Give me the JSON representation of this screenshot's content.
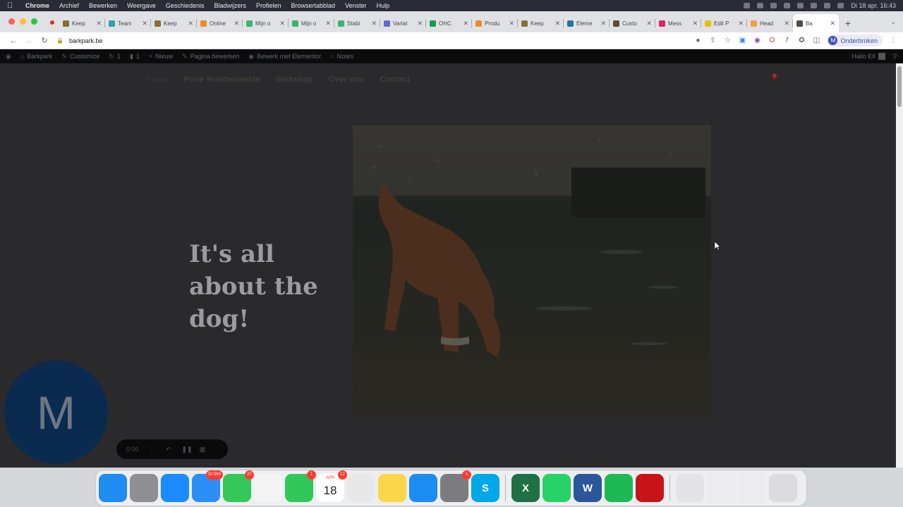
{
  "menubar": {
    "app": "Chrome",
    "items": [
      "Archief",
      "Bewerken",
      "Weergave",
      "Geschiedenis",
      "Bladwijzers",
      "Profielen",
      "Browsertabblad",
      "Venster",
      "Hulp"
    ],
    "clock": "Di 18 apr. 16:43"
  },
  "tabs": [
    {
      "label": "Keep",
      "color": "#8a6d2f"
    },
    {
      "label": "Team",
      "color": "#2aa6a0"
    },
    {
      "label": "Keep",
      "color": "#8a6d2f"
    },
    {
      "label": "Online",
      "color": "#f08a24"
    },
    {
      "label": "Mijn o",
      "color": "#3bb27a"
    },
    {
      "label": "Mijn o",
      "color": "#3bb27a"
    },
    {
      "label": "Stabi",
      "color": "#3bb27a"
    },
    {
      "label": "Variat",
      "color": "#5b6bd6"
    },
    {
      "label": "OHC",
      "color": "#0f9d58"
    },
    {
      "label": "Produ",
      "color": "#f08a24"
    },
    {
      "label": "Keep",
      "color": "#8a6d2f"
    },
    {
      "label": "Eleme",
      "color": "#21759b"
    },
    {
      "label": "Custo",
      "color": "#5a4a3a"
    },
    {
      "label": "Mess",
      "color": "#e0245e"
    },
    {
      "label": "Edit P",
      "color": "#e5c100"
    },
    {
      "label": "Head",
      "color": "#f0a040"
    },
    {
      "label": "Ba",
      "color": "#5a4a3a"
    }
  ],
  "toolbar": {
    "url": "barkpark.be",
    "profile_label": "Onderbroken",
    "profile_initial": "M"
  },
  "adminbar": {
    "site": "Barkpark",
    "customize": "Customize",
    "updates": "1",
    "comments": "1",
    "new": "Nieuw",
    "edit": "Pagina bewerken",
    "elementor": "Bewerk met Elementor",
    "notes": "Notes",
    "hello": "Hallo Ell"
  },
  "site": {
    "nav": [
      "Home",
      "Privé Hondenweide",
      "Webshop",
      "Over ons",
      "Contact"
    ],
    "cart_count": "0",
    "hero_title": "It's all about the dog!"
  },
  "recorder": {
    "bubble_initial": "M",
    "timer": "0:00"
  },
  "dock": [
    {
      "name": "finder",
      "color": "#1e8cf0",
      "glyph": ""
    },
    {
      "name": "launchpad",
      "color": "#8e8e93",
      "glyph": ""
    },
    {
      "name": "safari",
      "color": "#1a8cff",
      "glyph": ""
    },
    {
      "name": "mail",
      "color": "#2c8ff5",
      "glyph": "",
      "badge": "32.564"
    },
    {
      "name": "messages",
      "color": "#34c759",
      "glyph": "",
      "badge": "27"
    },
    {
      "name": "photos",
      "color": "#f4f4f4",
      "glyph": ""
    },
    {
      "name": "facetime",
      "color": "#30c85a",
      "glyph": "",
      "badge": "1"
    },
    {
      "name": "calendar",
      "color": "#ffffff",
      "glyph": "",
      "month": "APR",
      "day": "18",
      "badge": "12"
    },
    {
      "name": "chrome",
      "color": "#e8e8e8",
      "glyph": ""
    },
    {
      "name": "notes",
      "color": "#f9d648",
      "glyph": ""
    },
    {
      "name": "app-store",
      "color": "#1b8df2",
      "glyph": ""
    },
    {
      "name": "system-settings",
      "color": "#7c7c80",
      "glyph": "",
      "badge": "1"
    },
    {
      "name": "skype",
      "color": "#00a8e8",
      "glyph": "S"
    },
    {
      "name": "excel",
      "color": "#1e7145",
      "glyph": "X"
    },
    {
      "name": "whatsapp",
      "color": "#25d366",
      "glyph": ""
    },
    {
      "name": "word",
      "color": "#2b579a",
      "glyph": "W"
    },
    {
      "name": "spotify",
      "color": "#1db954",
      "glyph": ""
    },
    {
      "name": "acrobat",
      "color": "#c7141a",
      "glyph": ""
    },
    {
      "name": "file-1",
      "color": "#e4e4e6",
      "glyph": ""
    },
    {
      "name": "file-2",
      "color": "#ececee",
      "glyph": ""
    },
    {
      "name": "file-3",
      "color": "#ececee",
      "glyph": ""
    },
    {
      "name": "trash",
      "color": "#dcdcdf",
      "glyph": ""
    }
  ]
}
